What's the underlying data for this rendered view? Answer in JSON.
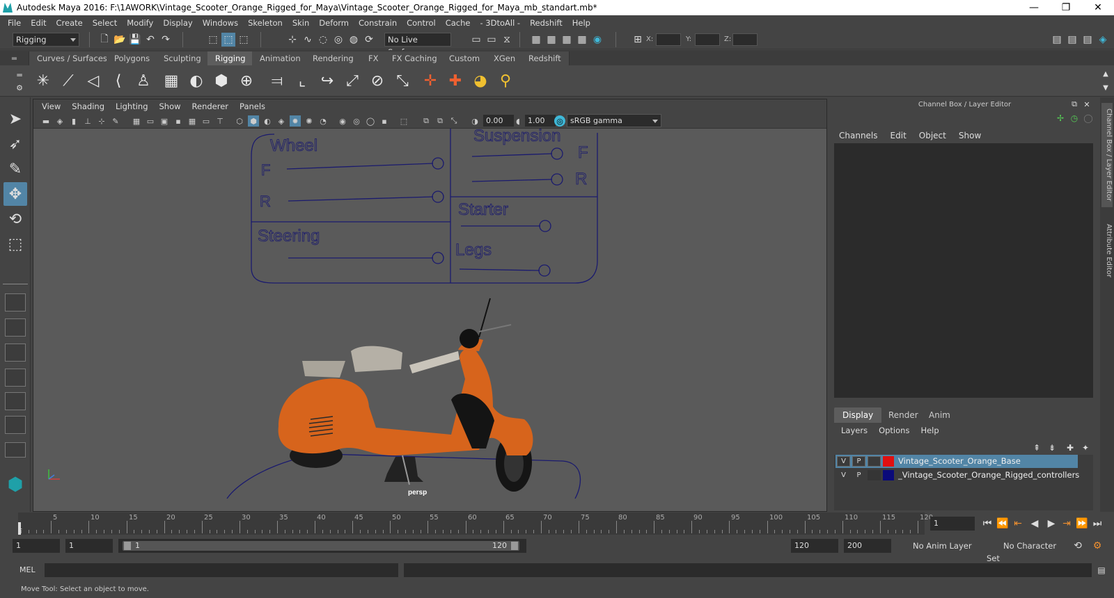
{
  "window": {
    "title": "Autodesk Maya 2016: F:\\1AWORK\\Vintage_Scooter_Orange_Rigged_for_Maya\\Vintage_Scooter_Orange_Rigged_for_Maya_mb_standart.mb*",
    "minimize": "—",
    "maximize": "❐",
    "close": "✕"
  },
  "menu": [
    "File",
    "Edit",
    "Create",
    "Select",
    "Modify",
    "Display",
    "Windows",
    "Skeleton",
    "Skin",
    "Deform",
    "Constrain",
    "Control",
    "Cache",
    "- 3DtoAll -",
    "Redshift",
    "Help"
  ],
  "statusline": {
    "mode": "Rigging",
    "live_surface": "No Live Surface",
    "x_label": "X:",
    "y_label": "Y:",
    "z_label": "Z:"
  },
  "shelf_tabs": [
    "Curves / Surfaces",
    "Polygons",
    "Sculpting",
    "Rigging",
    "Animation",
    "Rendering",
    "FX",
    "FX Caching",
    "Custom",
    "XGen",
    "Redshift"
  ],
  "active_shelf": "Rigging",
  "viewport": {
    "menu": [
      "View",
      "Shading",
      "Lighting",
      "Show",
      "Renderer",
      "Panels"
    ],
    "exposure": "0.00",
    "gamma": "1.00",
    "color_space": "sRGB gamma",
    "camera_label": "persp"
  },
  "controller_board": {
    "wheel": "Wheel",
    "wheel_f": "F",
    "wheel_r": "R",
    "suspension": "Suspension",
    "susp_f": "F",
    "susp_r": "R",
    "steering": "Steering",
    "starter": "Starter",
    "legs": "Legs",
    "line_color": "#1a1a6e"
  },
  "scooter_color": "#d7641c",
  "channel_box": {
    "header": "Channel Box / Layer Editor",
    "menu": [
      "Channels",
      "Edit",
      "Object",
      "Show"
    ]
  },
  "layer_editor": {
    "tabs": [
      "Display",
      "Render",
      "Anim"
    ],
    "active_tab": "Display",
    "menu": [
      "Layers",
      "Options",
      "Help"
    ],
    "layers": [
      {
        "v": "V",
        "p": "P",
        "color": "#e01010",
        "name": "Vintage_Scooter_Orange_Base",
        "selected": true
      },
      {
        "v": "V",
        "p": "P",
        "color": "#0a0a7a",
        "name": "_Vintage_Scooter_Orange_Rigged_controllers",
        "selected": false
      }
    ]
  },
  "side_tabs": [
    "Channel Box / Layer Editor",
    "Attribute Editor"
  ],
  "timeline": {
    "ticks": [
      5,
      10,
      15,
      20,
      25,
      30,
      35,
      40,
      45,
      50,
      55,
      60,
      65,
      70,
      75,
      80,
      85,
      90,
      95,
      100,
      105,
      110,
      115,
      120
    ],
    "start_label": "1",
    "current_frame": "1"
  },
  "range": {
    "start": "1",
    "playback_start": "1",
    "slider_start": "1",
    "slider_end": "120",
    "playback_end": "120",
    "end": "200",
    "anim_layer": "No Anim Layer",
    "character_set": "No Character Set"
  },
  "command": {
    "label": "MEL"
  },
  "status_message": "Move Tool: Select an object to move."
}
